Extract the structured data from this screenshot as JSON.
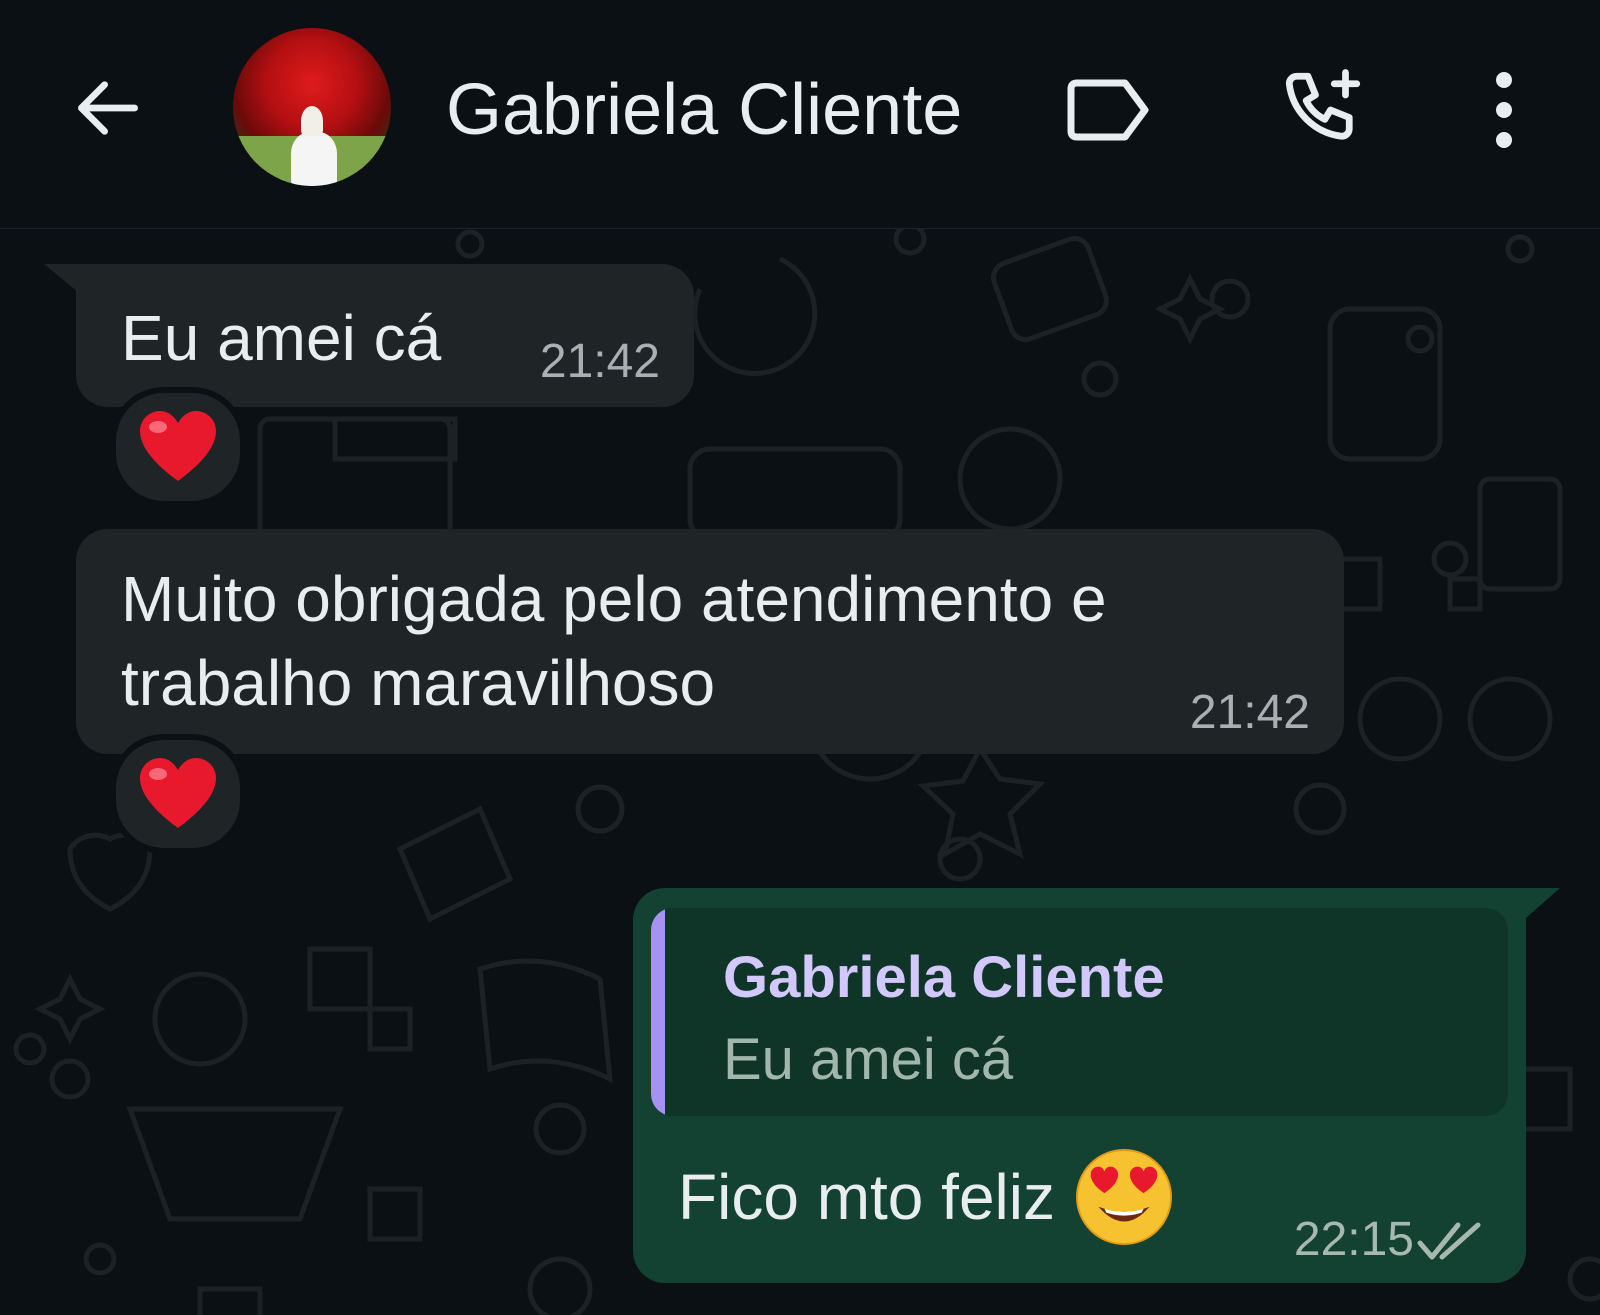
{
  "header": {
    "contact_name": "Gabriela Cliente",
    "icons": [
      "back-arrow-icon",
      "label-tag-icon",
      "add-call-icon",
      "more-vert-icon"
    ]
  },
  "messages": [
    {
      "direction": "incoming",
      "text": "Eu amei cá",
      "time": "21:42",
      "reaction": "❤️"
    },
    {
      "direction": "incoming",
      "text": "Muito obrigada pelo atendimento e trabalho maravilhoso",
      "time": "21:42",
      "reaction": "❤️"
    },
    {
      "direction": "outgoing",
      "quote": {
        "author": "Gabriela Cliente",
        "text": "Eu amei cá"
      },
      "text": "Fico mto feliz",
      "emoji": "😍",
      "time": "22:15",
      "status": "read-double-check"
    }
  ],
  "colors": {
    "background": "#0b1014",
    "incoming_bubble": "#1f2427",
    "outgoing_bubble": "#134232",
    "quote_accent": "#a791f2",
    "quote_author": "#d3c8fb"
  }
}
